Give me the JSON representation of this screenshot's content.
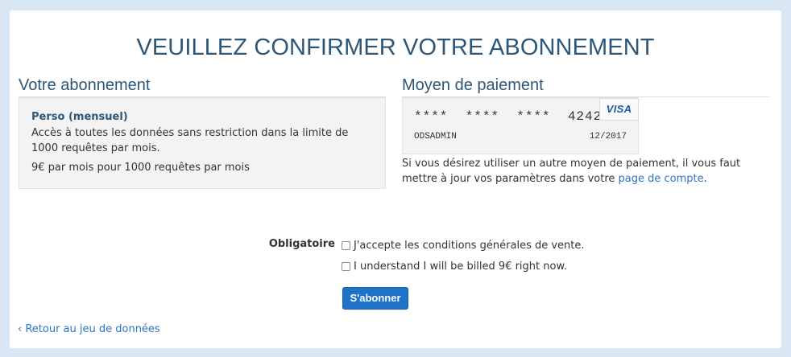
{
  "page": {
    "title": "VEUILLEZ CONFIRMER VOTRE ABONNEMENT"
  },
  "subscription": {
    "heading": "Votre abonnement",
    "plan_name": "Perso (mensuel)",
    "description": "Accès à toutes les données sans restriction dans la limite de 1000 requêtes par mois.",
    "price": "9€ par mois pour 1000 requêtes par mois"
  },
  "payment": {
    "heading": "Moyen de paiement",
    "card_number": "****  ****  ****  4242",
    "card_holder": "ODSADMIN",
    "card_expiry": "12/2017",
    "card_brand": "VISA",
    "note_text": "Si vous désirez utiliser un autre moyen de paiement, il vous faut mettre à jour vos paramètres dans votre ",
    "note_link": "page de compte",
    "note_end": "."
  },
  "terms": {
    "required_label": "Obligatoire",
    "checkbox_conditions": "J'accepte les conditions générales de vente.",
    "checkbox_billing": "I understand I will be billed 9€ right now."
  },
  "actions": {
    "subscribe_label": "S'abonner",
    "back_link": "‹ Retour au jeu de données"
  },
  "colors": {
    "accent": "#2e5676",
    "link": "#2e75c6",
    "button": "#1e73c8",
    "background": "#d9e7f5"
  }
}
